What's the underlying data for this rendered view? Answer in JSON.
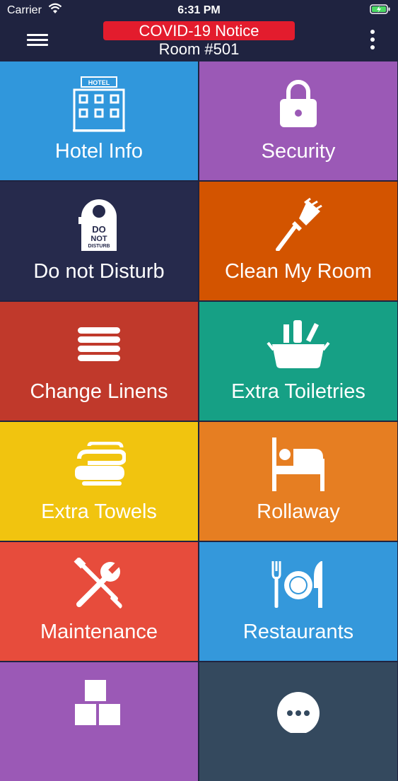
{
  "status_bar": {
    "carrier": "Carrier",
    "time": "6:31 PM"
  },
  "header": {
    "notice": "COVID-19 Notice",
    "room": "Room #501",
    "menu_icon": "hamburger-icon",
    "more_icon": "more-vertical-icon"
  },
  "tiles": [
    {
      "label": "Hotel Info",
      "color": "#3097dc",
      "icon": "hotel-icon",
      "icon_text": "HOTEL"
    },
    {
      "label": "Security",
      "color": "#9b59b6",
      "icon": "lock-icon"
    },
    {
      "label": "Do not Disturb",
      "color": "#262a4c",
      "icon": "do-not-disturb-icon",
      "icon_text": "DO NOT DISTURB"
    },
    {
      "label": "Clean My Room",
      "color": "#d35400",
      "icon": "duster-icon"
    },
    {
      "label": "Change Linens",
      "color": "#c0392b",
      "icon": "linens-icon"
    },
    {
      "label": "Extra Toiletries",
      "color": "#16a085",
      "icon": "toiletries-icon"
    },
    {
      "label": "Extra Towels",
      "color": "#f1c40f",
      "icon": "towels-icon"
    },
    {
      "label": "Rollaway",
      "color": "#e67e22",
      "icon": "bed-icon"
    },
    {
      "label": "Maintenance",
      "color": "#e74c3c",
      "icon": "tools-icon"
    },
    {
      "label": "Restaurants",
      "color": "#3498db",
      "icon": "dining-icon"
    },
    {
      "label": "",
      "color": "#9b59b6",
      "icon": "boxes-icon"
    },
    {
      "label": "",
      "color": "#34495e",
      "icon": "chat-icon"
    }
  ]
}
